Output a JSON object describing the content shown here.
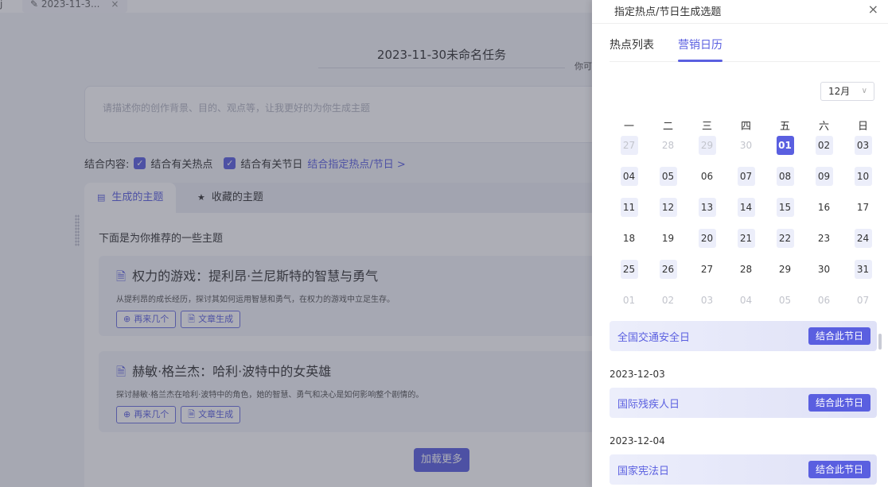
{
  "tabbar": {
    "left_edge": "j",
    "doc_tab_label": "✎ 2023-11-3...",
    "doc_tab_close": "×"
  },
  "editor": {
    "title": "2023-11-30未命名任务",
    "side_hint": "你可",
    "prompt_placeholder": "请描述你的创作背景、目的、观点等，让我更好的为你生成主题"
  },
  "combine": {
    "label": "结合内容:",
    "opt1": "结合有关热点",
    "opt2": "结合有关节日",
    "link": "结合指定热点/节日 >"
  },
  "topic_tabs": [
    {
      "label": "生成的主题",
      "icon": "list-icon"
    },
    {
      "label": "收藏的主题",
      "icon": "star-icon"
    }
  ],
  "recommend_text": "下面是为你推荐的一些主题",
  "topics": [
    {
      "title": "权力的游戏：提利昂·兰尼斯特的智慧与勇气",
      "desc": "从提利昂的成长经历，探讨其如何运用智慧和勇气，在权力的游戏中立足生存。",
      "btn_more": "再来几个",
      "btn_article": "文章生成"
    },
    {
      "title": "赫敏·格兰杰：哈利·波特中的女英雄",
      "desc": "探讨赫敏·格兰杰在哈利·波特中的角色，她的智慧、勇气和决心是如何影响整个剧情的。",
      "btn_more": "再来几个",
      "btn_article": "文章生成"
    }
  ],
  "load_more": "加载更多",
  "drawer": {
    "title": "指定热点/节日生成选题",
    "close": "×",
    "tabs": [
      "热点列表",
      "营销日历"
    ],
    "month": "12月",
    "weekdays": [
      "一",
      "二",
      "三",
      "四",
      "五",
      "六",
      "日"
    ],
    "days": [
      {
        "d": "27",
        "state": "muted-hl"
      },
      {
        "d": "28",
        "state": "muted"
      },
      {
        "d": "29",
        "state": "muted-hl"
      },
      {
        "d": "30",
        "state": "muted"
      },
      {
        "d": "01",
        "state": "selected"
      },
      {
        "d": "02",
        "state": "hl"
      },
      {
        "d": "03",
        "state": "hl"
      },
      {
        "d": "04",
        "state": "hl"
      },
      {
        "d": "05",
        "state": "hl"
      },
      {
        "d": "06",
        "state": "plain"
      },
      {
        "d": "07",
        "state": "hl"
      },
      {
        "d": "08",
        "state": "hl"
      },
      {
        "d": "09",
        "state": "hl"
      },
      {
        "d": "10",
        "state": "hl"
      },
      {
        "d": "11",
        "state": "hl"
      },
      {
        "d": "12",
        "state": "hl"
      },
      {
        "d": "13",
        "state": "hl"
      },
      {
        "d": "14",
        "state": "hl"
      },
      {
        "d": "15",
        "state": "hl"
      },
      {
        "d": "16",
        "state": "plain"
      },
      {
        "d": "17",
        "state": "plain"
      },
      {
        "d": "18",
        "state": "plain"
      },
      {
        "d": "19",
        "state": "plain"
      },
      {
        "d": "20",
        "state": "hl"
      },
      {
        "d": "21",
        "state": "hl"
      },
      {
        "d": "22",
        "state": "hl"
      },
      {
        "d": "23",
        "state": "plain"
      },
      {
        "d": "24",
        "state": "hl"
      },
      {
        "d": "25",
        "state": "hl"
      },
      {
        "d": "26",
        "state": "hl"
      },
      {
        "d": "27",
        "state": "plain"
      },
      {
        "d": "28",
        "state": "plain"
      },
      {
        "d": "29",
        "state": "plain"
      },
      {
        "d": "30",
        "state": "plain"
      },
      {
        "d": "31",
        "state": "hl"
      },
      {
        "d": "01",
        "state": "muted"
      },
      {
        "d": "02",
        "state": "muted"
      },
      {
        "d": "03",
        "state": "muted"
      },
      {
        "d": "04",
        "state": "muted"
      },
      {
        "d": "05",
        "state": "muted"
      },
      {
        "d": "06",
        "state": "muted"
      },
      {
        "d": "07",
        "state": "muted"
      }
    ],
    "holidays": [
      {
        "date": "",
        "name": "全国交通安全日",
        "btn": "结合此节日"
      },
      {
        "date": "2023-12-03",
        "name": "国际残疾人日",
        "btn": "结合此节日"
      },
      {
        "date": "2023-12-04",
        "name": "国家宪法日",
        "btn": "结合此节日"
      }
    ]
  },
  "colors": {
    "accent": "#5a5fe0",
    "highlight": "#eceefa",
    "overlay": "rgba(60,62,82,0.42)"
  }
}
